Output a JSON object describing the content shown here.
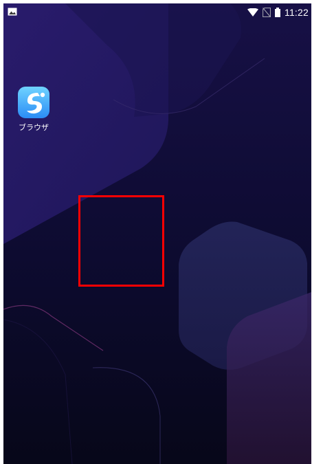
{
  "status_bar": {
    "time": "11:22",
    "icons": [
      "image-notification-icon",
      "wifi-icon",
      "no-sim-icon",
      "battery-icon"
    ]
  },
  "home_screen": {
    "apps": [
      {
        "label": "ブラウザ",
        "icon": "browser-app-icon"
      }
    ]
  },
  "colors": {
    "background": "#0b0a2a",
    "highlight_box": "#ff0000",
    "app_icon_gradient_top": "#6fd3ff",
    "app_icon_gradient_bottom": "#2b8cf5"
  }
}
